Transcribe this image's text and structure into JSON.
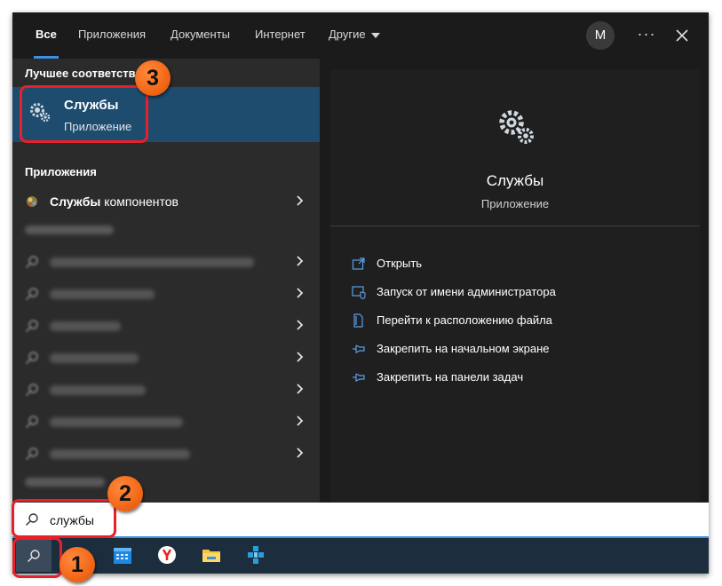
{
  "tabs": [
    {
      "label": "Все",
      "active": true
    },
    {
      "label": "Приложения",
      "active": false
    },
    {
      "label": "Документы",
      "active": false
    },
    {
      "label": "Интернет",
      "active": false
    },
    {
      "label": "Другие",
      "active": false
    }
  ],
  "header": {
    "avatar": "M",
    "more": "···"
  },
  "left": {
    "best_heading": "Лучшее соответствие",
    "best_match": {
      "title": "Службы",
      "subtitle": "Приложение",
      "icon": "gear-icon"
    },
    "apps_heading": "Приложения",
    "app_item": {
      "bold": "Службы",
      "rest": " компонентов",
      "icon": "component-services-icon"
    }
  },
  "preview": {
    "title": "Службы",
    "subtitle": "Приложение",
    "actions": [
      {
        "label": "Открыть",
        "icon": "open-icon"
      },
      {
        "label": "Запуск от имени администратора",
        "icon": "shield-icon"
      },
      {
        "label": "Перейти к расположению файла",
        "icon": "file-location-icon"
      },
      {
        "label": "Закрепить на начальном экране",
        "icon": "pin-icon"
      },
      {
        "label": "Закрепить на панели задач",
        "icon": "pin-icon"
      }
    ]
  },
  "search": {
    "value": "службы"
  },
  "annotations": [
    "1",
    "2",
    "3"
  ],
  "colors": {
    "accent": "#3d8fe0",
    "selected": "#1d4c6e",
    "annotation": "#e8202a",
    "badge": "#f46a1a"
  }
}
